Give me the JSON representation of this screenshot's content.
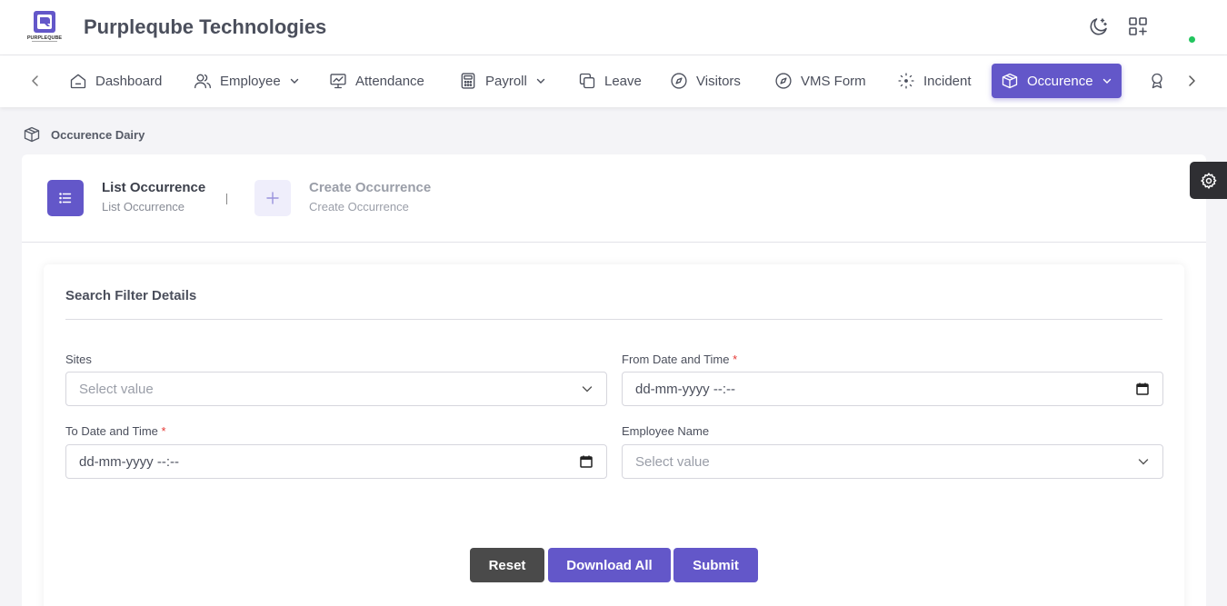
{
  "header": {
    "logo_text": "PURPLEQUBE",
    "company": "Purpleqube Technologies",
    "icons": [
      "theme-toggle-icon",
      "apps-grid-icon"
    ],
    "status_color": "#22c55e"
  },
  "nav": {
    "items": [
      {
        "label": "Dashboard",
        "icon": "home-icon"
      },
      {
        "label": "Employee",
        "icon": "users-icon",
        "dropdown": true
      },
      {
        "label": "Attendance",
        "icon": "monitor-chart-icon"
      },
      {
        "label": "Payroll",
        "icon": "calculator-icon",
        "dropdown": true
      },
      {
        "label": "Leave",
        "icon": "copy-icon"
      },
      {
        "label": "Visitors",
        "icon": "compass-icon"
      },
      {
        "label": "VMS Form",
        "icon": "compass-icon"
      },
      {
        "label": "Incident",
        "icon": "focus-icon"
      },
      {
        "label": "Occurence",
        "icon": "box-icon",
        "dropdown": true,
        "active": true
      }
    ],
    "accent": "#6357c9"
  },
  "breadcrumb": {
    "label": "Occurence Dairy"
  },
  "steps": {
    "list": {
      "title": "List Occurrence",
      "subtitle": "List Occurrence"
    },
    "create": {
      "title": "Create Occurrence",
      "subtitle": "Create Occurrence"
    }
  },
  "filter": {
    "title": "Search Filter Details",
    "sites": {
      "label": "Sites",
      "placeholder": "Select value"
    },
    "from": {
      "label": "From Date and Time",
      "required": "*",
      "value": "dd-mm-yyyy --:--"
    },
    "to": {
      "label": "To Date and Time",
      "required": "*",
      "value": "dd-mm-yyyy --:--"
    },
    "employee": {
      "label": "Employee Name",
      "placeholder": "Select value"
    }
  },
  "buttons": {
    "reset": "Reset",
    "download": "Download All",
    "submit": "Submit"
  }
}
